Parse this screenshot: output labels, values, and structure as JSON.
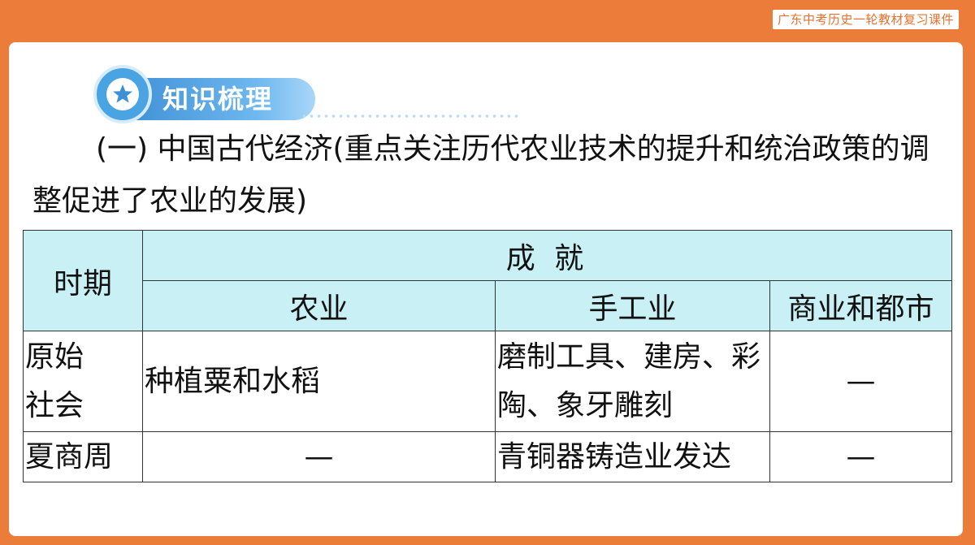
{
  "header": {
    "course_tag": "广东中考历史一轮教材复习课件"
  },
  "section_badge": {
    "icon": "star-icon",
    "title": "知识梳理",
    "accent": "#4aa3e2"
  },
  "heading": {
    "text": "(一) 中国古代经济(重点关注历代农业技术的提升和统治政策的调整促进了农业的发展)"
  },
  "table": {
    "header_period": "时期",
    "header_achievements": "成 就",
    "columns": {
      "agriculture": "农业",
      "handicraft": "手工业",
      "commerce": "商业和都市"
    },
    "rows": [
      {
        "period": "原始社会",
        "agriculture": "种植粟和水稻",
        "handicraft": "磨制工具、建房、彩陶、象牙雕刻",
        "commerce": "—"
      },
      {
        "period": "夏商周",
        "agriculture": "—",
        "handicraft": "青铜器铸造业发达",
        "commerce": "—"
      }
    ]
  },
  "colors": {
    "frame": "#ec7c3a",
    "table_header_bg": "#c9f0f4"
  }
}
